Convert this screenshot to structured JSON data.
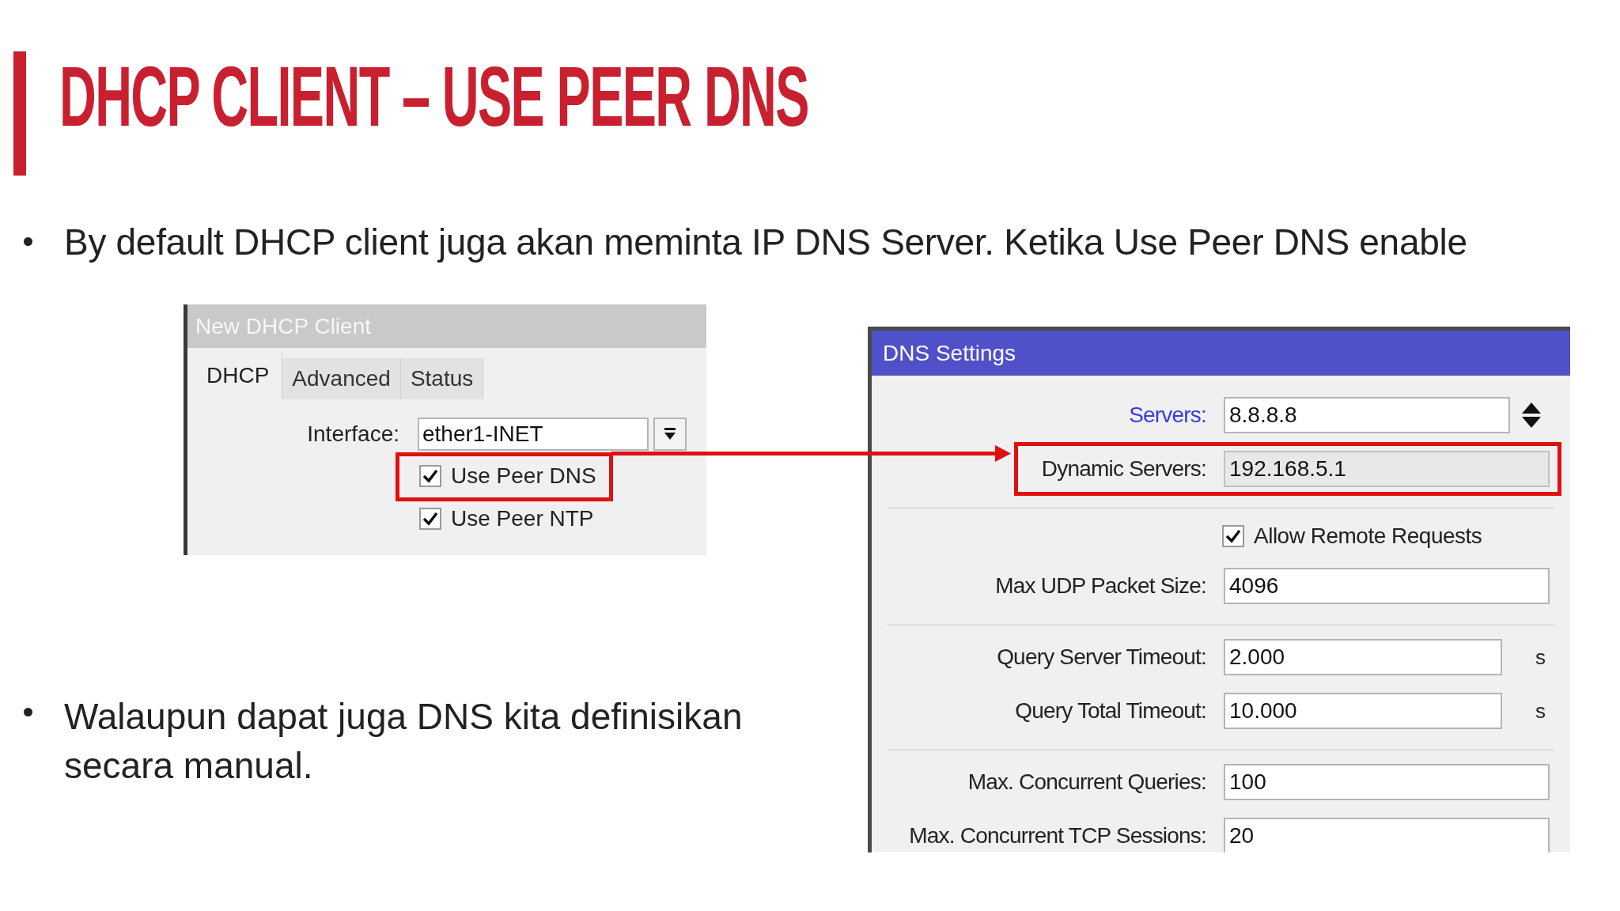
{
  "slide": {
    "title": "DHCP CLIENT – USE PEER DNS",
    "bullets": [
      "By default DHCP client juga akan meminta IP DNS Server. Ketika Use Peer DNS enable",
      "Walaupun dapat juga DNS kita definisikan secara manual."
    ]
  },
  "dhcp_client_window": {
    "title": "New DHCP Client",
    "tabs": [
      {
        "label": "DHCP",
        "selected": true
      },
      {
        "label": "Advanced",
        "selected": false
      },
      {
        "label": "Status",
        "selected": false
      }
    ],
    "interface": {
      "label": "Interface:",
      "value": "ether1-INET"
    },
    "checkboxes": [
      {
        "label": "Use Peer DNS",
        "checked": true,
        "highlighted": true
      },
      {
        "label": "Use Peer NTP",
        "checked": true,
        "highlighted": false
      }
    ]
  },
  "dns_settings_window": {
    "title": "DNS Settings",
    "rows": [
      {
        "kind": "list_field",
        "label": "Servers:",
        "value": "8.8.8.8",
        "highlighted": false
      },
      {
        "kind": "readonly_field",
        "label": "Dynamic Servers:",
        "value": "192.168.5.1",
        "highlighted": true
      },
      {
        "kind": "separator"
      },
      {
        "kind": "checkbox",
        "label": "Allow Remote Requests",
        "checked": true
      },
      {
        "kind": "field",
        "label": "Max UDP Packet Size:",
        "value": "4096",
        "highlighted": false
      },
      {
        "kind": "separator"
      },
      {
        "kind": "field",
        "label": "Query Server Timeout:",
        "value": "2.000",
        "unit": "s",
        "highlighted": false
      },
      {
        "kind": "field",
        "label": "Query Total Timeout:",
        "value": "10.000",
        "unit": "s",
        "highlighted": false
      },
      {
        "kind": "separator"
      },
      {
        "kind": "field",
        "label": "Max. Concurrent Queries:",
        "value": "100",
        "highlighted": false
      },
      {
        "kind": "field",
        "label": "Max. Concurrent TCP Sessions:",
        "value": "20",
        "highlighted": false
      }
    ]
  }
}
